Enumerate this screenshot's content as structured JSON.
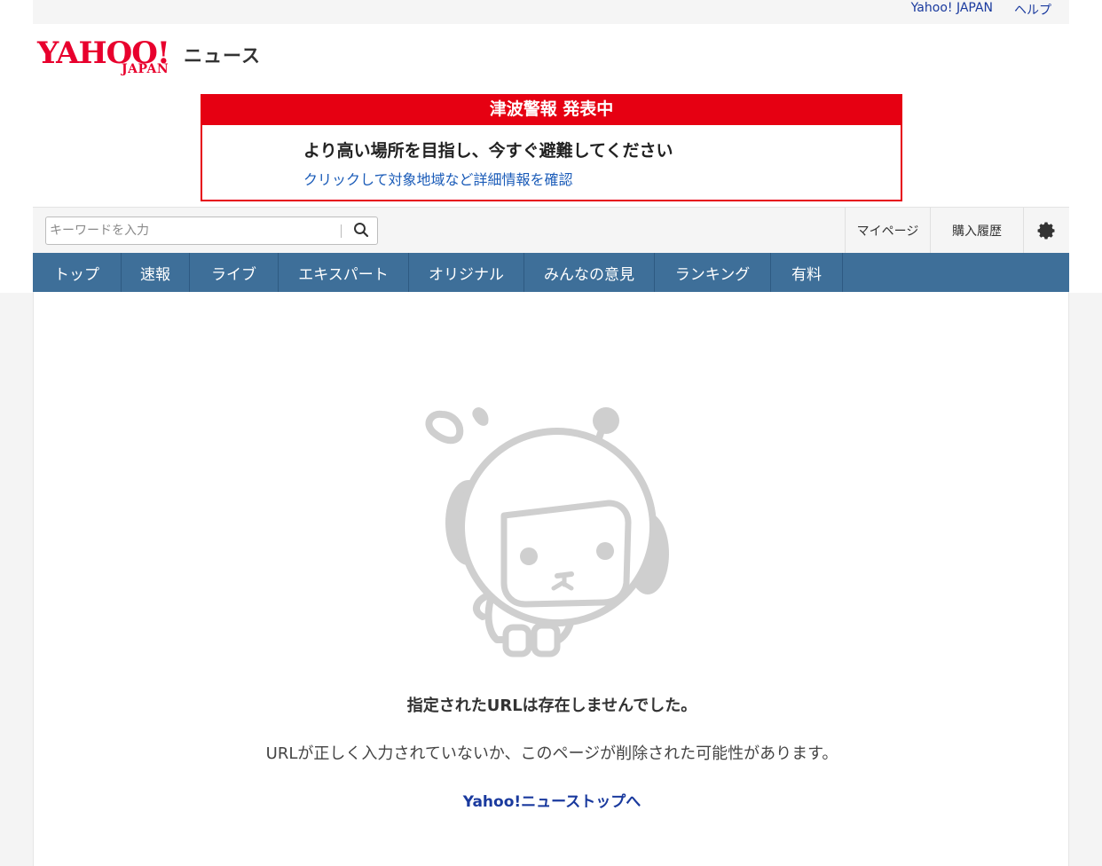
{
  "utility": {
    "yahoo_japan": "Yahoo! JAPAN",
    "help": "ヘルプ"
  },
  "logo": {
    "main": "YAHOO!",
    "sub": "JAPAN",
    "news": "ニュース"
  },
  "alert": {
    "heading": "津波警報 発表中",
    "message": "より高い場所を目指し、今すぐ避難してください",
    "link": "クリックして対象地域など詳細情報を確認",
    "color": "#e60012"
  },
  "search": {
    "placeholder": "キーワードを入力",
    "icon": "search-icon"
  },
  "tools": {
    "mypage": "マイページ",
    "history": "購入履歴",
    "settings_icon": "gear-icon"
  },
  "nav": {
    "color": "#3e6f99",
    "items": [
      {
        "label": "トップ"
      },
      {
        "label": "速報"
      },
      {
        "label": "ライブ"
      },
      {
        "label": "エキスパート"
      },
      {
        "label": "オリジナル"
      },
      {
        "label": "みんなの意見"
      },
      {
        "label": "ランキング"
      },
      {
        "label": "有料"
      }
    ]
  },
  "error": {
    "title": "指定されたURLは存在しませんでした。",
    "description": "URLが正しく入力されていないか、このページが削除された可能性があります。",
    "link": "Yahoo!ニューストップへ"
  }
}
